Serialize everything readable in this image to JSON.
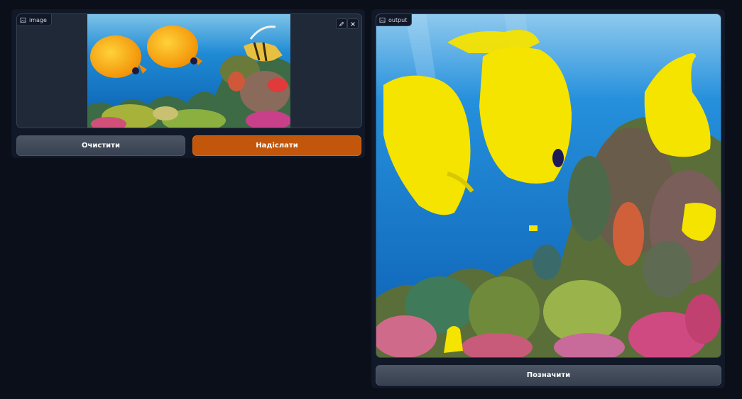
{
  "input": {
    "label": "image",
    "edit_icon": "pencil-icon",
    "close_icon": "close-icon"
  },
  "output": {
    "label": "output"
  },
  "buttons": {
    "clear": "Очистити",
    "submit": "Надіслати",
    "flag": "Позначити"
  },
  "colors": {
    "primary": "#c2570c",
    "background": "#0b0f19",
    "panel": "#111827"
  }
}
